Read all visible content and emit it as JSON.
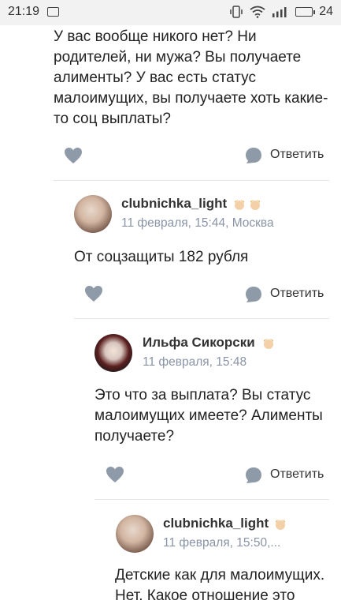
{
  "status_bar": {
    "time": "21:19",
    "battery": "24"
  },
  "top_comment": {
    "text": "У вас вообще никого нет? Ни родителей, ни мужа? Вы получаете алименты? У вас есть статус малоимущих, вы получаете хоть какие-то соц выплаты?",
    "reply_label": "Ответить"
  },
  "replies": [
    {
      "author": "clubnichka_light",
      "meta": "11 февраля, 15:44, Москва",
      "text": "От соцзащиты 182 рубля",
      "reply_label": "Ответить"
    },
    {
      "author": "Ильфа Сикорски",
      "meta": "11 февраля, 15:48",
      "text": "Это что за выплата? Вы статус малоимущих имеете? Алименты получаете?",
      "reply_label": "Ответить"
    },
    {
      "author": "clubnichka_light",
      "meta": "11 февраля, 15:50,...",
      "text": "Детские как для малоимущих. Нет. Какое отношение это"
    }
  ],
  "colors": {
    "icon_gray": "#8f9aa8",
    "meta_gray": "#8a94a6",
    "badge_gold": "#f0c27a"
  }
}
